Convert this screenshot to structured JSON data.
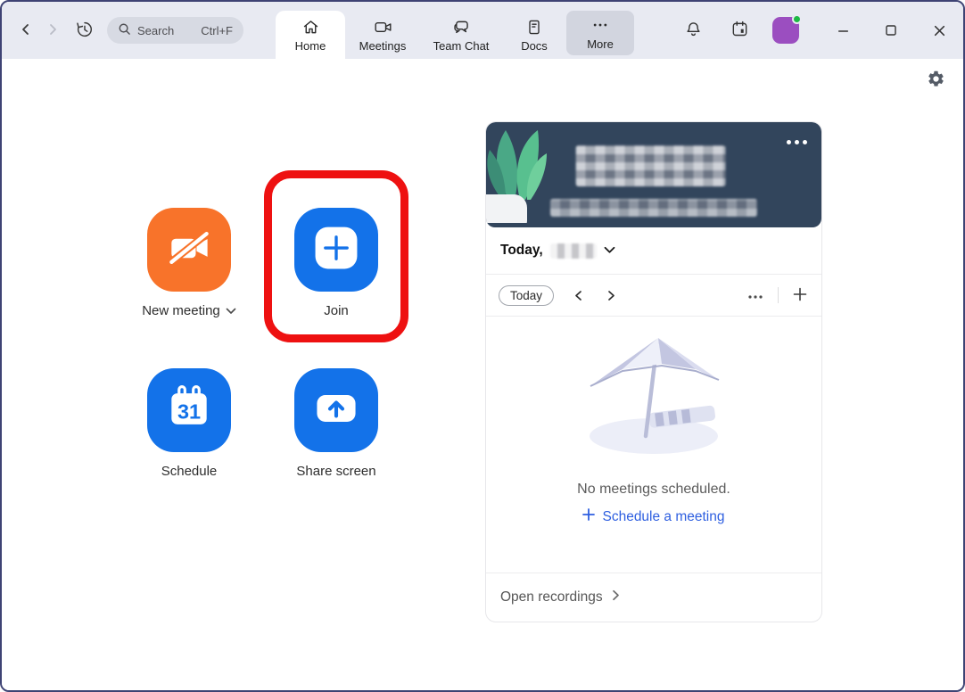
{
  "topbar": {
    "search": {
      "label": "Search",
      "shortcut": "Ctrl+F"
    },
    "tabs": [
      {
        "label": "Home"
      },
      {
        "label": "Meetings"
      },
      {
        "label": "Team Chat"
      },
      {
        "label": "Docs"
      },
      {
        "label": "More"
      }
    ]
  },
  "actions": {
    "new_meeting": {
      "label": "New meeting"
    },
    "join": {
      "label": "Join"
    },
    "schedule": {
      "label": "Schedule",
      "calendar_day": "31"
    },
    "share_screen": {
      "label": "Share screen"
    }
  },
  "panel": {
    "today_prefix": "Today,",
    "toolbar": {
      "today_button": "Today"
    },
    "empty": {
      "message": "No meetings scheduled.",
      "cta": "Schedule a meeting"
    },
    "recordings": {
      "label": "Open recordings"
    }
  },
  "icons": {
    "back": "chevron-left",
    "forward": "chevron-right",
    "history": "clock-restore-arrow",
    "search": "magnifier",
    "home": "house",
    "meetings": "video-camera",
    "team_chat": "chat-bubbles",
    "docs": "document",
    "more": "ellipsis",
    "notifications": "bell",
    "calendar": "calendar",
    "settings": "gear",
    "header_menu": "ellipsis",
    "add": "plus"
  },
  "colors": {
    "brand_blue": "#1372e9",
    "new_meeting_orange": "#f8732a",
    "annotation_red": "#ee1111",
    "avatar_purple": "#9b4ec0",
    "presence_green": "#1cb944",
    "header_navy": "#32455c",
    "link_blue": "#2e5fe0",
    "topbar_bg": "#e8eaf2",
    "window_border": "#3e4374"
  }
}
